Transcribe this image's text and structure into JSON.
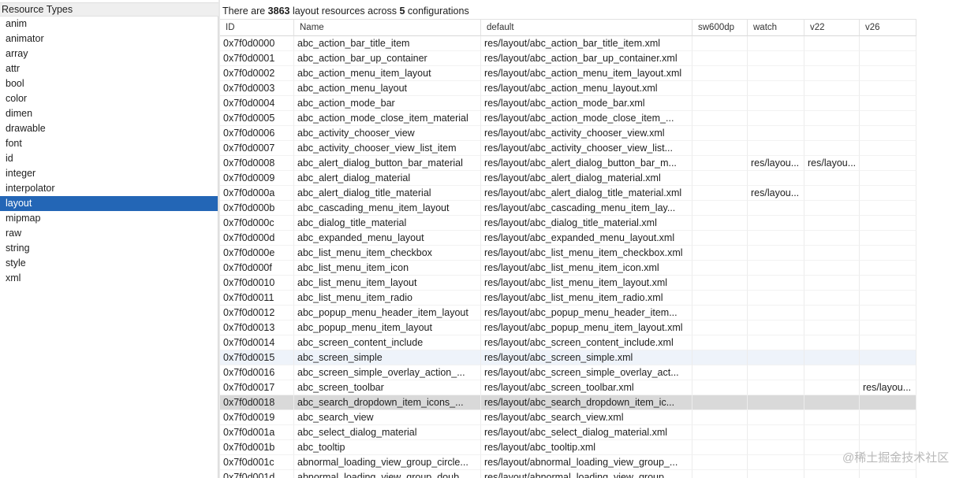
{
  "left_panel": {
    "header": "Resource Types",
    "items": [
      "anim",
      "animator",
      "array",
      "attr",
      "bool",
      "color",
      "dimen",
      "drawable",
      "font",
      "id",
      "integer",
      "interpolator",
      "layout",
      "mipmap",
      "raw",
      "string",
      "style",
      "xml"
    ],
    "selected_index": 12
  },
  "summary": {
    "prefix": "There are ",
    "count": "3863",
    "middle": " layout resources across ",
    "configs": "5",
    "suffix": " configurations"
  },
  "table": {
    "columns": [
      "ID",
      "Name",
      "default",
      "sw600dp",
      "watch",
      "v22",
      "v26"
    ],
    "rows": [
      [
        "0x7f0d0000",
        "abc_action_bar_title_item",
        "res/layout/abc_action_bar_title_item.xml",
        "",
        "",
        "",
        ""
      ],
      [
        "0x7f0d0001",
        "abc_action_bar_up_container",
        "res/layout/abc_action_bar_up_container.xml",
        "",
        "",
        "",
        ""
      ],
      [
        "0x7f0d0002",
        "abc_action_menu_item_layout",
        "res/layout/abc_action_menu_item_layout.xml",
        "",
        "",
        "",
        ""
      ],
      [
        "0x7f0d0003",
        "abc_action_menu_layout",
        "res/layout/abc_action_menu_layout.xml",
        "",
        "",
        "",
        ""
      ],
      [
        "0x7f0d0004",
        "abc_action_mode_bar",
        "res/layout/abc_action_mode_bar.xml",
        "",
        "",
        "",
        ""
      ],
      [
        "0x7f0d0005",
        "abc_action_mode_close_item_material",
        "res/layout/abc_action_mode_close_item_...",
        "",
        "",
        "",
        ""
      ],
      [
        "0x7f0d0006",
        "abc_activity_chooser_view",
        "res/layout/abc_activity_chooser_view.xml",
        "",
        "",
        "",
        ""
      ],
      [
        "0x7f0d0007",
        "abc_activity_chooser_view_list_item",
        "res/layout/abc_activity_chooser_view_list...",
        "",
        "",
        "",
        ""
      ],
      [
        "0x7f0d0008",
        "abc_alert_dialog_button_bar_material",
        "res/layout/abc_alert_dialog_button_bar_m...",
        "",
        "res/layou...",
        "res/layou...",
        ""
      ],
      [
        "0x7f0d0009",
        "abc_alert_dialog_material",
        "res/layout/abc_alert_dialog_material.xml",
        "",
        "",
        "",
        ""
      ],
      [
        "0x7f0d000a",
        "abc_alert_dialog_title_material",
        "res/layout/abc_alert_dialog_title_material.xml",
        "",
        "res/layou...",
        "",
        ""
      ],
      [
        "0x7f0d000b",
        "abc_cascading_menu_item_layout",
        "res/layout/abc_cascading_menu_item_lay...",
        "",
        "",
        "",
        ""
      ],
      [
        "0x7f0d000c",
        "abc_dialog_title_material",
        "res/layout/abc_dialog_title_material.xml",
        "",
        "",
        "",
        ""
      ],
      [
        "0x7f0d000d",
        "abc_expanded_menu_layout",
        "res/layout/abc_expanded_menu_layout.xml",
        "",
        "",
        "",
        ""
      ],
      [
        "0x7f0d000e",
        "abc_list_menu_item_checkbox",
        "res/layout/abc_list_menu_item_checkbox.xml",
        "",
        "",
        "",
        ""
      ],
      [
        "0x7f0d000f",
        "abc_list_menu_item_icon",
        "res/layout/abc_list_menu_item_icon.xml",
        "",
        "",
        "",
        ""
      ],
      [
        "0x7f0d0010",
        "abc_list_menu_item_layout",
        "res/layout/abc_list_menu_item_layout.xml",
        "",
        "",
        "",
        ""
      ],
      [
        "0x7f0d0011",
        "abc_list_menu_item_radio",
        "res/layout/abc_list_menu_item_radio.xml",
        "",
        "",
        "",
        ""
      ],
      [
        "0x7f0d0012",
        "abc_popup_menu_header_item_layout",
        "res/layout/abc_popup_menu_header_item...",
        "",
        "",
        "",
        ""
      ],
      [
        "0x7f0d0013",
        "abc_popup_menu_item_layout",
        "res/layout/abc_popup_menu_item_layout.xml",
        "",
        "",
        "",
        ""
      ],
      [
        "0x7f0d0014",
        "abc_screen_content_include",
        "res/layout/abc_screen_content_include.xml",
        "",
        "",
        "",
        ""
      ],
      [
        "0x7f0d0015",
        "abc_screen_simple",
        "res/layout/abc_screen_simple.xml",
        "",
        "",
        "",
        ""
      ],
      [
        "0x7f0d0016",
        "abc_screen_simple_overlay_action_...",
        "res/layout/abc_screen_simple_overlay_act...",
        "",
        "",
        "",
        ""
      ],
      [
        "0x7f0d0017",
        "abc_screen_toolbar",
        "res/layout/abc_screen_toolbar.xml",
        "",
        "",
        "",
        "res/layou..."
      ],
      [
        "0x7f0d0018",
        "abc_search_dropdown_item_icons_...",
        "res/layout/abc_search_dropdown_item_ic...",
        "",
        "",
        "",
        ""
      ],
      [
        "0x7f0d0019",
        "abc_search_view",
        "res/layout/abc_search_view.xml",
        "",
        "",
        "",
        ""
      ],
      [
        "0x7f0d001a",
        "abc_select_dialog_material",
        "res/layout/abc_select_dialog_material.xml",
        "",
        "",
        "",
        ""
      ],
      [
        "0x7f0d001b",
        "abc_tooltip",
        "res/layout/abc_tooltip.xml",
        "",
        "",
        "",
        ""
      ],
      [
        "0x7f0d001c",
        "abnormal_loading_view_group_circle...",
        "res/layout/abnormal_loading_view_group_...",
        "",
        "",
        "",
        ""
      ],
      [
        "0x7f0d001d",
        "abnormal_loading_view_group_doub...",
        "res/layout/abnormal_loading_view_group_...",
        "",
        "",
        "",
        ""
      ]
    ],
    "highlight_light_index": 21,
    "highlight_gray_index": 24
  },
  "watermark": "@稀土掘金技术社区",
  "colors": {
    "selection": "#2366b6",
    "row_highlight": "#eef3fa",
    "row_selected_gray": "#d9d9d9"
  }
}
